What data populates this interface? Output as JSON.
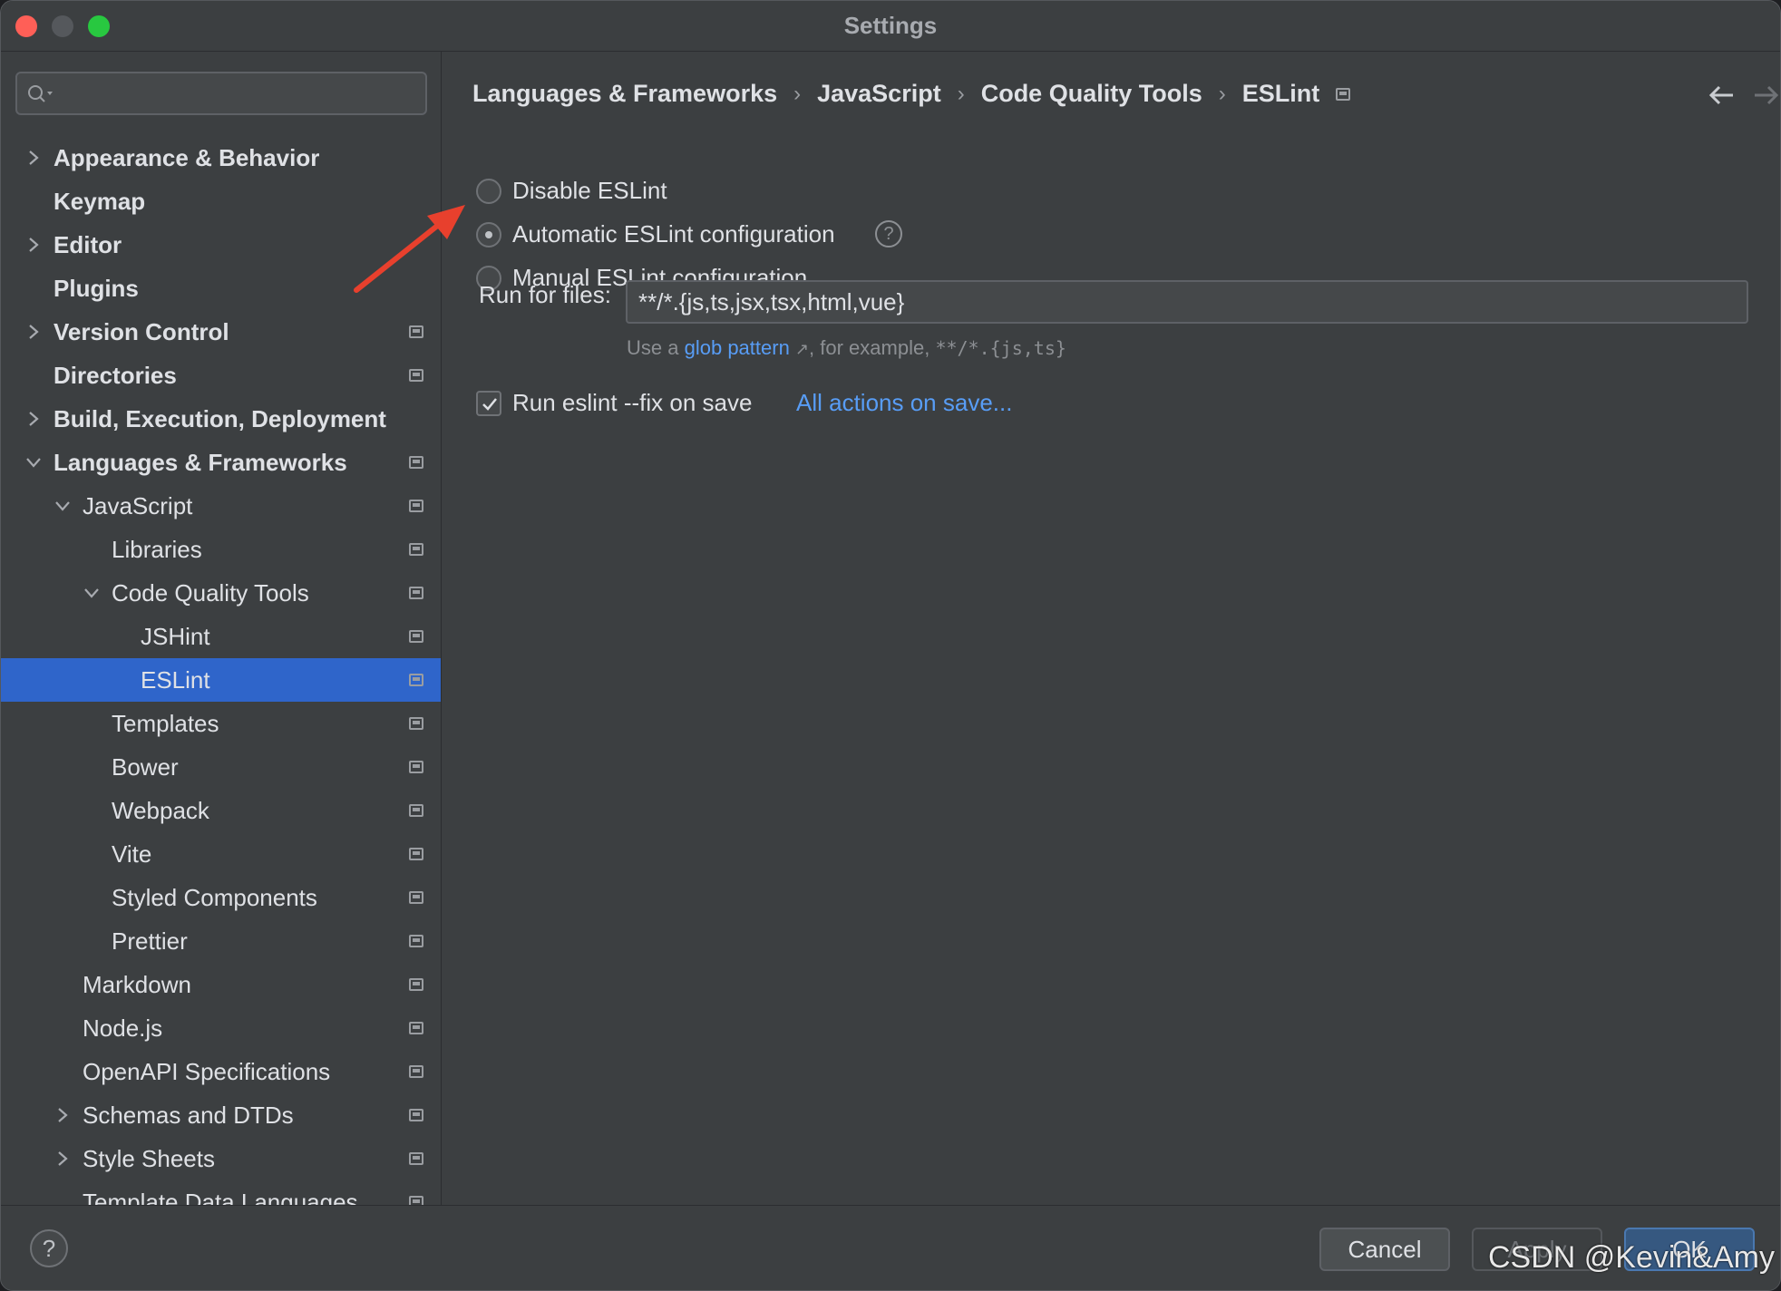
{
  "window": {
    "title": "Settings"
  },
  "sidebar": {
    "search_placeholder": "",
    "items": [
      {
        "label": "Appearance & Behavior",
        "level": 0,
        "bold": true,
        "chevron": "right",
        "proj": false
      },
      {
        "label": "Keymap",
        "level": 0,
        "bold": true,
        "chevron": "none",
        "proj": false
      },
      {
        "label": "Editor",
        "level": 0,
        "bold": true,
        "chevron": "right",
        "proj": false
      },
      {
        "label": "Plugins",
        "level": 0,
        "bold": true,
        "chevron": "none",
        "proj": false
      },
      {
        "label": "Version Control",
        "level": 0,
        "bold": true,
        "chevron": "right",
        "proj": true
      },
      {
        "label": "Directories",
        "level": 0,
        "bold": true,
        "chevron": "none",
        "proj": true
      },
      {
        "label": "Build, Execution, Deployment",
        "level": 0,
        "bold": true,
        "chevron": "right",
        "proj": false
      },
      {
        "label": "Languages & Frameworks",
        "level": 0,
        "bold": true,
        "chevron": "down",
        "proj": true
      },
      {
        "label": "JavaScript",
        "level": 1,
        "bold": false,
        "chevron": "down",
        "proj": true
      },
      {
        "label": "Libraries",
        "level": 2,
        "bold": false,
        "chevron": "none",
        "proj": true
      },
      {
        "label": "Code Quality Tools",
        "level": 2,
        "bold": false,
        "chevron": "down",
        "proj": true
      },
      {
        "label": "JSHint",
        "level": 3,
        "bold": false,
        "chevron": "none",
        "proj": true
      },
      {
        "label": "ESLint",
        "level": 3,
        "bold": false,
        "chevron": "none",
        "proj": true,
        "selected": true
      },
      {
        "label": "Templates",
        "level": 2,
        "bold": false,
        "chevron": "none",
        "proj": true
      },
      {
        "label": "Bower",
        "level": 2,
        "bold": false,
        "chevron": "none",
        "proj": true
      },
      {
        "label": "Webpack",
        "level": 2,
        "bold": false,
        "chevron": "none",
        "proj": true
      },
      {
        "label": "Vite",
        "level": 2,
        "bold": false,
        "chevron": "none",
        "proj": true
      },
      {
        "label": "Styled Components",
        "level": 2,
        "bold": false,
        "chevron": "none",
        "proj": true
      },
      {
        "label": "Prettier",
        "level": 2,
        "bold": false,
        "chevron": "none",
        "proj": true
      },
      {
        "label": "Markdown",
        "level": 1,
        "bold": false,
        "chevron": "none",
        "proj": true
      },
      {
        "label": "Node.js",
        "level": 1,
        "bold": false,
        "chevron": "none",
        "proj": true
      },
      {
        "label": "OpenAPI Specifications",
        "level": 1,
        "bold": false,
        "chevron": "none",
        "proj": true
      },
      {
        "label": "Schemas and DTDs",
        "level": 1,
        "bold": false,
        "chevron": "right",
        "proj": true
      },
      {
        "label": "Style Sheets",
        "level": 1,
        "bold": false,
        "chevron": "right",
        "proj": true
      },
      {
        "label": "Template Data Languages",
        "level": 1,
        "bold": false,
        "chevron": "none",
        "proj": true
      }
    ]
  },
  "breadcrumb": {
    "items": [
      "Languages & Frameworks",
      "JavaScript",
      "Code Quality Tools",
      "ESLint"
    ],
    "separator": "›"
  },
  "eslint": {
    "options": [
      {
        "label": "Disable ESLint",
        "checked": false
      },
      {
        "label": "Automatic ESLint configuration",
        "checked": true
      },
      {
        "label": "Manual ESLint configuration",
        "checked": false
      }
    ],
    "run_for_files_label": "Run for files:",
    "run_for_files_value": "**/*.{js,ts,jsx,tsx,html,vue}",
    "hint_prefix": "Use a",
    "hint_link": "glob pattern",
    "hint_arrow": "↗",
    "hint_middle": ", for example,",
    "hint_example": "**/*.{js,ts}",
    "fix_on_save_label": "Run eslint --fix on save",
    "fix_on_save_checked": true,
    "all_actions_link": "All actions on save..."
  },
  "footer": {
    "help": "?",
    "cancel": "Cancel",
    "apply": "Apply",
    "ok": "OK"
  },
  "watermark": "CSDN @Kevin&Amy",
  "colors": {
    "accent": "#2f65ca",
    "link": "#589df6",
    "annotation_arrow": "#e8402d"
  }
}
